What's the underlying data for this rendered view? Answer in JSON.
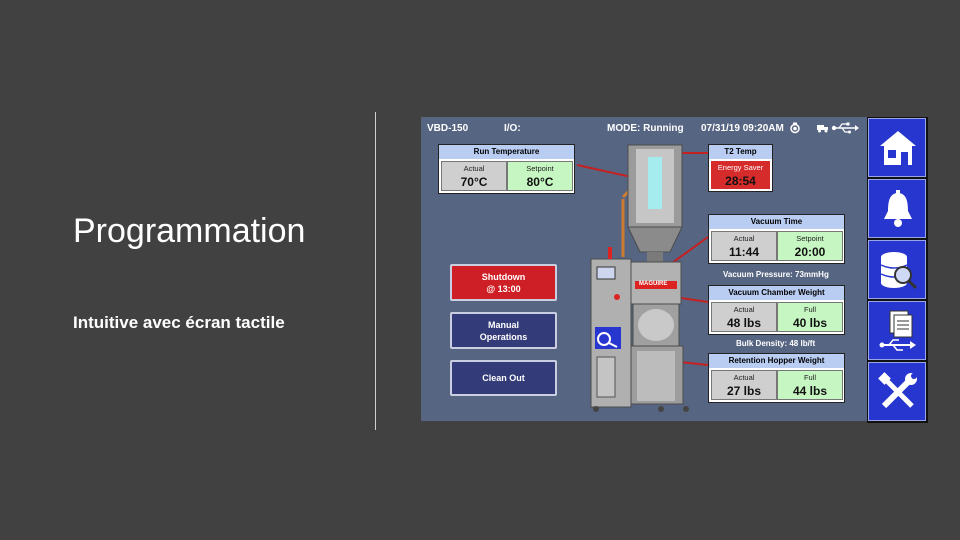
{
  "slide": {
    "title": "Programmation",
    "subtitle": "Intuitive avec écran tactile"
  },
  "hmi": {
    "model": "VBD-150",
    "io": "I/O:",
    "mode": "MODE: Running",
    "datetime": "07/31/19 09:20AM",
    "run_temperature": {
      "title": "Run Temperature",
      "actual_label": "Actual",
      "actual": "70°C",
      "setpoint_label": "Setpoint",
      "setpoint": "80°C"
    },
    "t2_temp": {
      "title": "T2 Temp",
      "status": "Energy Saver",
      "value": "28:54"
    },
    "vacuum_time": {
      "title": "Vacuum Time",
      "actual_label": "Actual",
      "actual": "11:44",
      "setpoint_label": "Setpoint",
      "setpoint": "20:00"
    },
    "vacuum_pressure": "Vacuum Pressure: 73mmHg",
    "vacuum_chamber_weight": {
      "title": "Vacuum Chamber Weight",
      "actual_label": "Actual",
      "actual": "48 lbs",
      "full_label": "Full",
      "full": "40 lbs"
    },
    "bulk_density": "Bulk Density: 48 lb/ft",
    "retention_hopper_weight": {
      "title": "Retention Hopper Weight",
      "actual_label": "Actual",
      "actual": "27 lbs",
      "full_label": "Full",
      "full": "44 lbs"
    },
    "buttons": {
      "shutdown_line1": "Shutdown",
      "shutdown_line2": "@ 13:00",
      "manual_line1": "Manual",
      "manual_line2": "Operations",
      "clean_out": "Clean Out"
    },
    "machine_label": "MAGUIRE",
    "colors": {
      "screen_bg": "#566582",
      "shutdown": "#cf1f26",
      "nav_button": "#2736cf",
      "setpoint_cell": "#c6f7c2",
      "alarm": "#d52b2b"
    }
  },
  "sidebar": {
    "items": [
      {
        "icon": "home-icon"
      },
      {
        "icon": "bell-icon"
      },
      {
        "icon": "database-search-icon"
      },
      {
        "icon": "documents-usb-icon"
      },
      {
        "icon": "tools-icon"
      }
    ]
  }
}
